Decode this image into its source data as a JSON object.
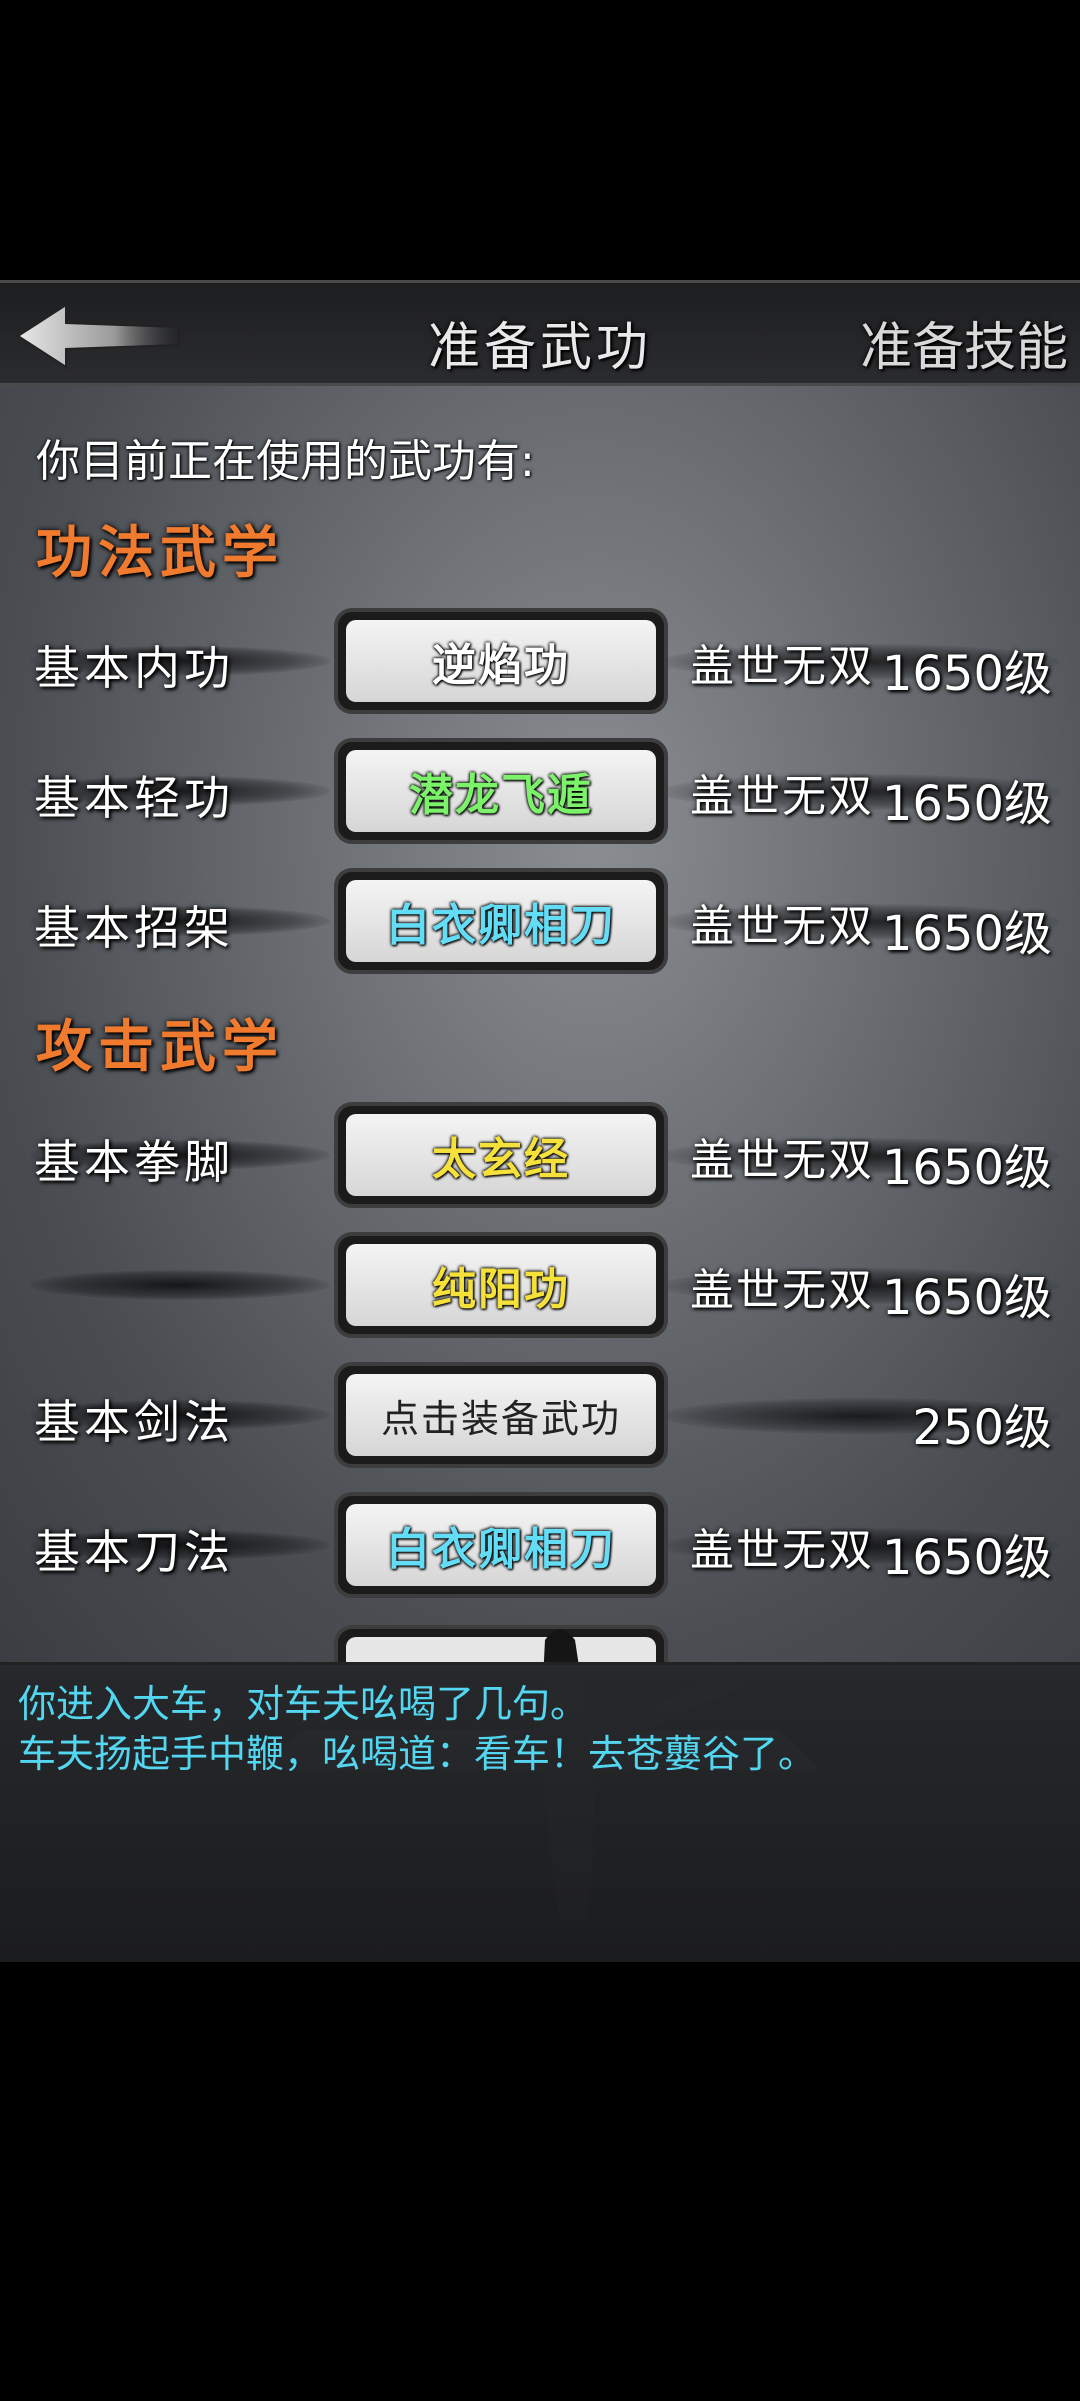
{
  "header": {
    "title": "准备武功",
    "right_tab": "准备技能"
  },
  "intro_text": "你目前正在使用的武功有:",
  "sections": [
    {
      "title": "功法武学",
      "rows": [
        {
          "label": "基本内功",
          "skill": "逆焰功",
          "skill_color": "#ffffff",
          "rank": "盖世无双",
          "level": "1650级"
        },
        {
          "label": "基本轻功",
          "skill": "潜龙飞遁",
          "skill_color": "#7cf26a",
          "rank": "盖世无双",
          "level": "1650级"
        },
        {
          "label": "基本招架",
          "skill": "白衣卿相刀",
          "skill_color": "#63dcf5",
          "rank": "盖世无双",
          "level": "1650级"
        }
      ]
    },
    {
      "title": "攻击武学",
      "rows": [
        {
          "label": "基本拳脚",
          "skill": "太玄经",
          "skill_color": "#f5e13a",
          "rank": "盖世无双",
          "level": "1650级"
        },
        {
          "label": "",
          "skill": "纯阳功",
          "skill_color": "#f5e13a",
          "rank": "盖世无双",
          "level": "1650级"
        },
        {
          "label": "基本剑法",
          "skill": "点击装备武功",
          "skill_color": "#222222",
          "rank": "",
          "level": "250级"
        },
        {
          "label": "基本刀法",
          "skill": "白衣卿相刀",
          "skill_color": "#63dcf5",
          "rank": "盖世无双",
          "level": "1650级"
        }
      ]
    }
  ],
  "log": [
    "你进入大车，对车夫吆喝了几句。",
    "车夫扬起手中鞭，吆喝道：看车！去苍蘡谷了。"
  ],
  "icons": {
    "back": "back-arrow-icon"
  }
}
